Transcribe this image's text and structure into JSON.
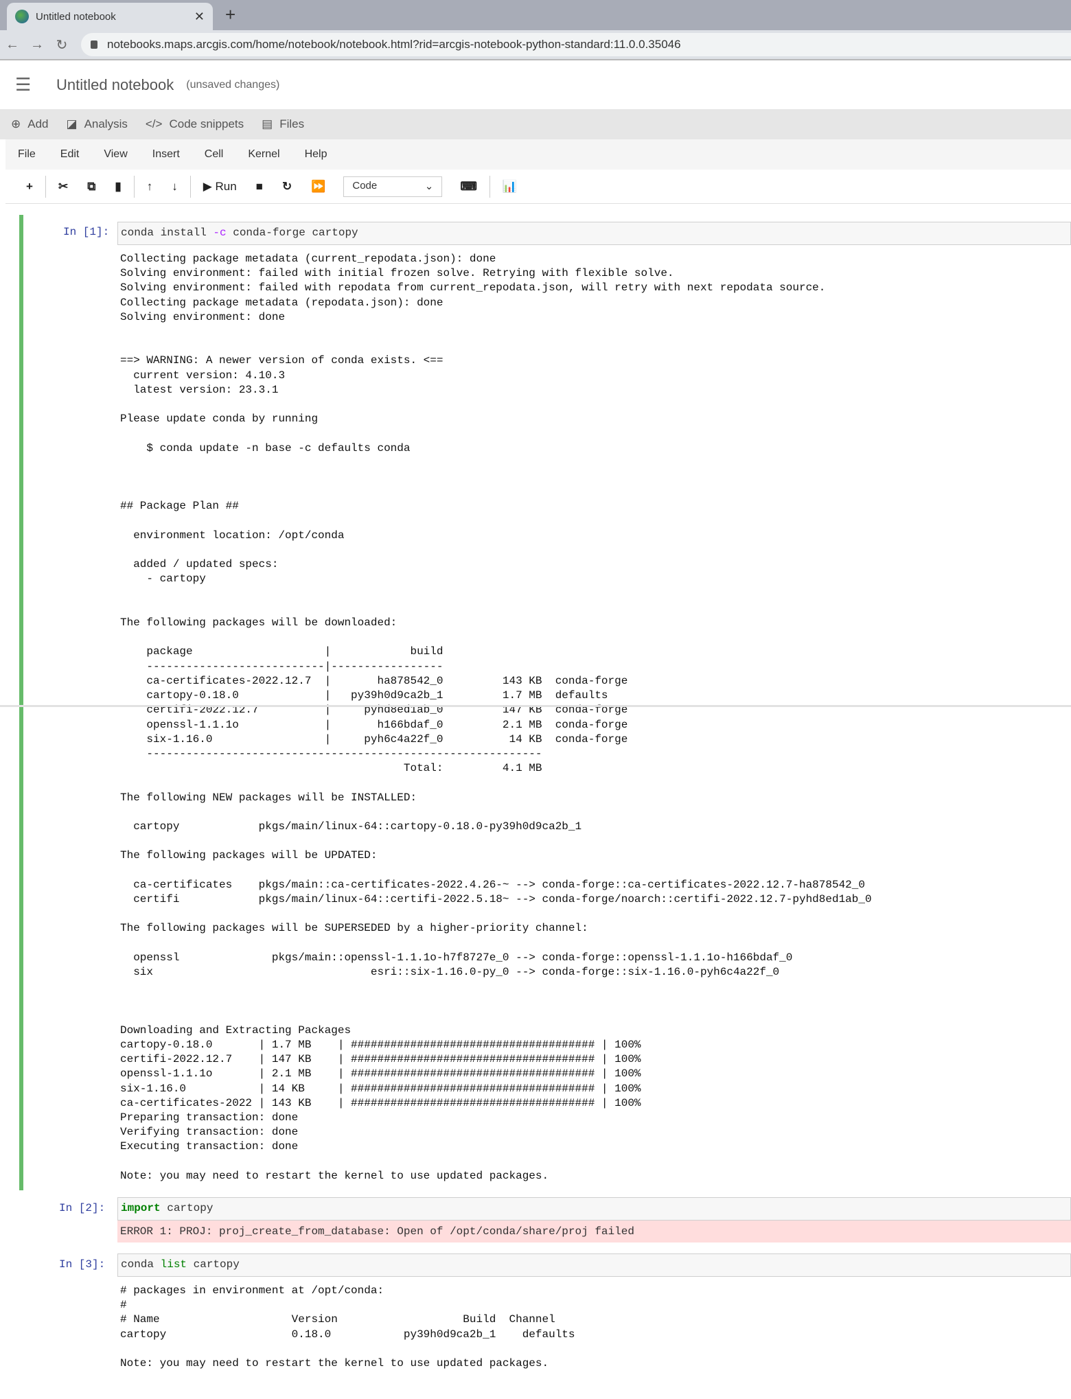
{
  "browser": {
    "tab_title": "Untitled notebook",
    "url": "notebooks.maps.arcgis.com/home/notebook/notebook.html?rid=arcgis-notebook-python-standard:11.0.0.35046"
  },
  "notebook": {
    "title": "Untitled notebook",
    "status": "(unsaved changes)"
  },
  "arc_toolbar": {
    "add": "Add",
    "analysis": "Analysis",
    "snippets": "Code snippets",
    "files": "Files"
  },
  "menu": [
    "File",
    "Edit",
    "View",
    "Insert",
    "Cell",
    "Kernel",
    "Help"
  ],
  "toolbar": {
    "run": "Run",
    "cell_type": "Code"
  },
  "cells": [
    {
      "prompt": "In [1]:",
      "code": [
        "conda install ",
        "-c",
        " conda-forge cartopy"
      ],
      "output": "Collecting package metadata (current_repodata.json): done\nSolving environment: failed with initial frozen solve. Retrying with flexible solve.\nSolving environment: failed with repodata from current_repodata.json, will retry with next repodata source.\nCollecting package metadata (repodata.json): done\nSolving environment: done\n\n\n==> WARNING: A newer version of conda exists. <==\n  current version: 4.10.3\n  latest version: 23.3.1\n\nPlease update conda by running\n\n    $ conda update -n base -c defaults conda\n\n\n\n## Package Plan ##\n\n  environment location: /opt/conda\n\n  added / updated specs:\n    - cartopy\n\n\nThe following packages will be downloaded:\n\n    package                    |            build\n    ---------------------------|-----------------\n    ca-certificates-2022.12.7  |       ha878542_0         143 KB  conda-forge\n    cartopy-0.18.0             |   py39h0d9ca2b_1         1.7 MB  defaults\n    certifi-2022.12.7          |     pyhd8ed1ab_0         147 KB  conda-forge\n    openssl-1.1.1o             |       h166bdaf_0         2.1 MB  conda-forge\n    six-1.16.0                 |     pyh6c4a22f_0          14 KB  conda-forge\n    ------------------------------------------------------------\n                                           Total:         4.1 MB\n\nThe following NEW packages will be INSTALLED:\n\n  cartopy            pkgs/main/linux-64::cartopy-0.18.0-py39h0d9ca2b_1\n\nThe following packages will be UPDATED:\n\n  ca-certificates    pkgs/main::ca-certificates-2022.4.26-~ --> conda-forge::ca-certificates-2022.12.7-ha878542_0\n  certifi            pkgs/main/linux-64::certifi-2022.5.18~ --> conda-forge/noarch::certifi-2022.12.7-pyhd8ed1ab_0\n\nThe following packages will be SUPERSEDED by a higher-priority channel:\n\n  openssl              pkgs/main::openssl-1.1.1o-h7f8727e_0 --> conda-forge::openssl-1.1.1o-h166bdaf_0\n  six                                 esri::six-1.16.0-py_0 --> conda-forge::six-1.16.0-pyh6c4a22f_0\n\n\n\nDownloading and Extracting Packages\ncartopy-0.18.0       | 1.7 MB    | ##################################### | 100%\ncertifi-2022.12.7    | 147 KB    | ##################################### | 100%\nopenssl-1.1.1o       | 2.1 MB    | ##################################### | 100%\nsix-1.16.0           | 14 KB     | ##################################### | 100%\nca-certificates-2022 | 143 KB    | ##################################### | 100%\nPreparing transaction: done\nVerifying transaction: done\nExecuting transaction: done\n\nNote: you may need to restart the kernel to use updated packages."
    },
    {
      "prompt": "In [2]:",
      "code": [
        "import",
        " cartopy"
      ],
      "error": "ERROR 1: PROJ: proj_create_from_database: Open of /opt/conda/share/proj failed"
    },
    {
      "prompt": "In [3]:",
      "code": [
        "conda ",
        "list",
        " cartopy"
      ],
      "output": "# packages in environment at /opt/conda:\n#\n# Name                    Version                   Build  Channel\ncartopy                   0.18.0           py39h0d9ca2b_1    defaults\n\nNote: you may need to restart the kernel to use updated packages."
    }
  ]
}
